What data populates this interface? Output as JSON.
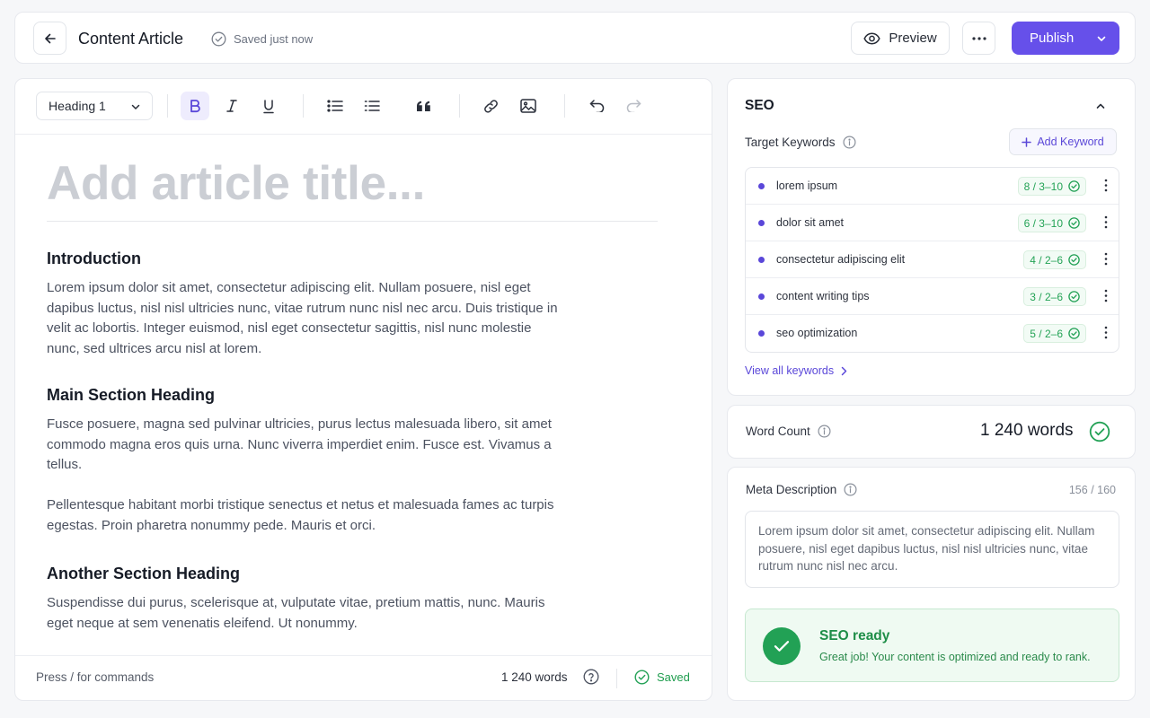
{
  "topbar": {
    "title": "Content Article",
    "saved_status": "Saved just now",
    "preview_label": "Preview",
    "publish_label": "Publish"
  },
  "toolbar": {
    "block_type": "Heading 1"
  },
  "editor": {
    "title_placeholder": "Add article title...",
    "sections": [
      {
        "heading": "Introduction",
        "paragraphs": [
          "Lorem ipsum dolor sit amet, consectetur adipiscing elit. Nullam posuere, nisl eget dapibus luctus, nisl nisl ultricies nunc, vitae rutrum nunc nisl nec arcu. Duis tristique in velit ac lobortis. Integer euismod, nisl eget consectetur sagittis, nisl nunc molestie nunc, sed ultrices arcu nisl at lorem."
        ]
      },
      {
        "heading": "Main Section Heading",
        "paragraphs": [
          "Fusce posuere, magna sed pulvinar ultricies, purus lectus malesuada libero, sit amet commodo magna eros quis urna. Nunc viverra imperdiet enim. Fusce est. Vivamus a tellus.",
          "Pellentesque habitant morbi tristique senectus et netus et malesuada fames ac turpis egestas. Proin pharetra nonummy pede. Mauris et orci."
        ]
      },
      {
        "heading": "Another Section Heading",
        "paragraphs": [
          "Suspendisse dui purus, scelerisque at, vulputate vitae, pretium mattis, nunc. Mauris eget neque at sem venenatis eleifend. Ut nonummy."
        ]
      }
    ],
    "footer": {
      "hint": "Press / for commands",
      "word_count": "1 240 words",
      "saved": "Saved"
    }
  },
  "seo": {
    "title": "SEO",
    "target_keywords_label": "Target Keywords",
    "add_keyword_label": "Add Keyword",
    "keywords": [
      {
        "text": "lorem ipsum",
        "count": "8 / 3–10"
      },
      {
        "text": "dolor sit amet",
        "count": "6 / 3–10"
      },
      {
        "text": "consectetur adipiscing elit",
        "count": "4 / 2–6"
      },
      {
        "text": "content writing tips",
        "count": "3 / 2–6"
      },
      {
        "text": "seo optimization",
        "count": "5 / 2–6"
      }
    ],
    "view_all_label": "View all keywords"
  },
  "word_count": {
    "label": "Word Count",
    "value": "1 240 words"
  },
  "meta": {
    "label": "Meta Description",
    "count": "156 / 160",
    "text": "Lorem ipsum dolor sit amet, consectetur adipiscing elit. Nullam posuere, nisl eget dapibus luctus, nisl nisl ultricies nunc, vitae rutrum nunc nisl nec arcu."
  },
  "seo_ready": {
    "title": "SEO ready",
    "subtitle": "Great job! Your content is optimized and ready to rank."
  },
  "colors": {
    "accent": "#6650ea",
    "success": "#22a155"
  }
}
